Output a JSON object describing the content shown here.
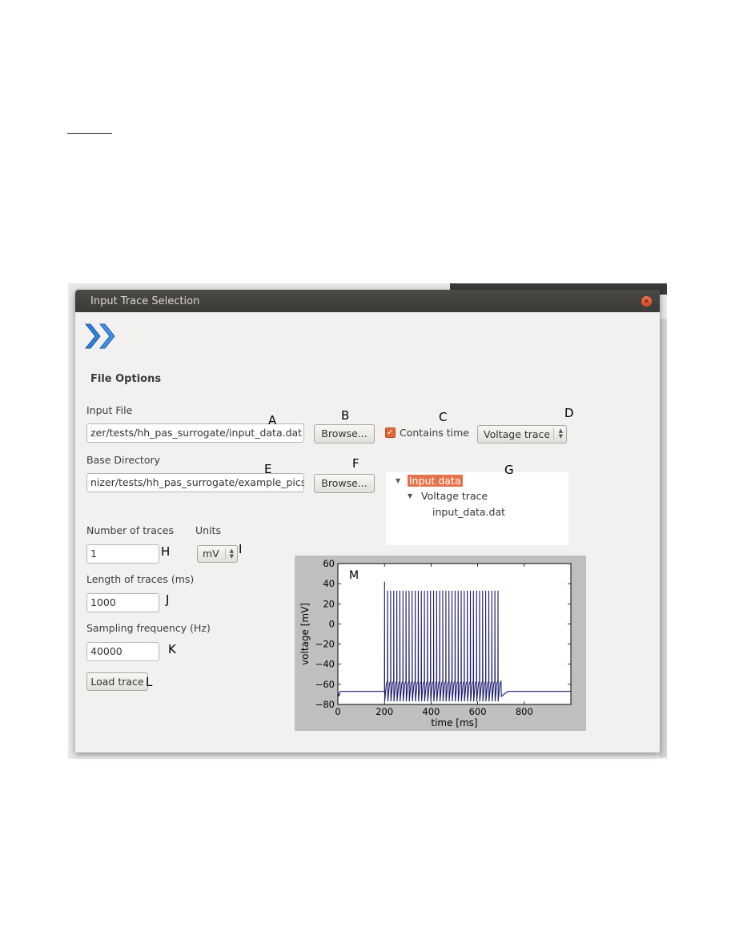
{
  "window": {
    "title": "Input Trace Selection",
    "close_glyph": "×"
  },
  "file_options": {
    "section_title": "File Options",
    "input_file_label": "Input File",
    "input_file_value": "zer/tests/hh_pas_surrogate/input_data.dat",
    "browse_input_label": "Browse...",
    "contains_time_label": "Contains time",
    "contains_time_checked": true,
    "trace_type_value": "Voltage trace",
    "base_dir_label": "Base Directory",
    "base_dir_value": "nizer/tests/hh_pas_surrogate/example_pics",
    "browse_base_label": "Browse..."
  },
  "tree": {
    "root": "Input data",
    "child": "Voltage trace",
    "leaf": "input_data.dat"
  },
  "params": {
    "num_traces_label": "Number of traces",
    "num_traces_value": "1",
    "units_label": "Units",
    "units_value": "mV",
    "length_label": "Length of traces (ms)",
    "length_value": "1000",
    "sampling_label": "Sampling frequency (Hz)",
    "sampling_value": "40000",
    "load_button": "Load trace"
  },
  "annotations": {
    "A": "A",
    "B": "B",
    "C": "C",
    "D": "D",
    "E": "E",
    "F": "F",
    "G": "G",
    "H": "H",
    "I": "I",
    "J": "J",
    "K": "K",
    "L": "L",
    "M": "M"
  },
  "icons": {
    "forward": "double-chevron-right-icon",
    "check": "checkmark-icon",
    "tree_expander": "triangle-down-icon"
  },
  "colors": {
    "accent": "#e67249",
    "titlebar": "#3b3a36",
    "trace": "#1a1a6e"
  },
  "chart_data": {
    "type": "line",
    "xlabel": "time [ms]",
    "ylabel": "voltage [mV]",
    "xlim": [
      0,
      1000
    ],
    "ylim": [
      -80,
      60
    ],
    "xticks": [
      0,
      200,
      400,
      600,
      800
    ],
    "yticks": [
      60,
      40,
      20,
      0,
      -20,
      -40,
      -60,
      -80
    ],
    "series": [
      {
        "rest_mV": -67,
        "stim_start_ms": 200,
        "stim_end_ms": 700,
        "first_spike_peak_mV": 42,
        "spike_peak_mV": 33,
        "trough_mV": -77,
        "spike_count": 38
      }
    ]
  }
}
